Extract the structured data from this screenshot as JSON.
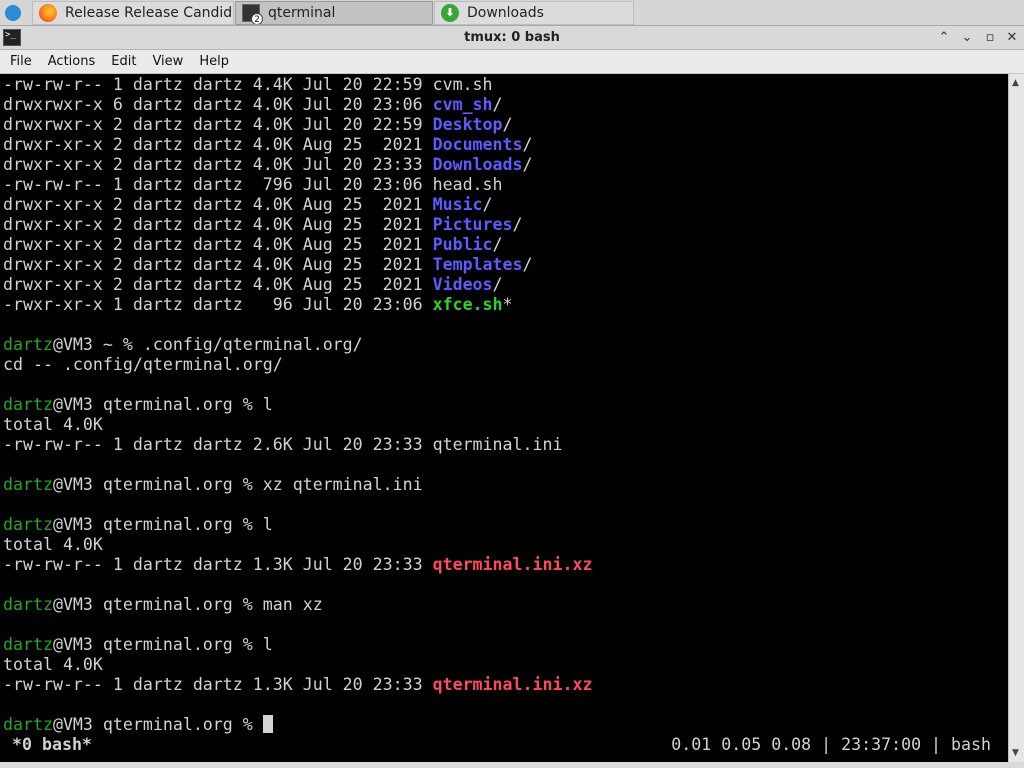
{
  "taskbar": {
    "tasks": [
      {
        "label": "Release Release Candid...",
        "icon": "firefox-icon"
      },
      {
        "label": "qterminal",
        "icon": "terminal-icon",
        "badge": "2"
      },
      {
        "label": "Downloads",
        "icon": "download-icon",
        "glyph": "⬇"
      }
    ]
  },
  "window": {
    "title": "tmux: 0 bash",
    "icon_glyph": ">_",
    "controls": {
      "minimize": "⌃",
      "restore": "⌄",
      "maximize": "▫",
      "close": "✕"
    }
  },
  "menu": {
    "file": "File",
    "actions": "Actions",
    "edit": "Edit",
    "view": "View",
    "help": "Help"
  },
  "terminal": {
    "listing": [
      {
        "meta": "-rw-rw-r-- 1 dartz dartz 4.4K Jul 20 22:59 ",
        "name": "cvm.sh",
        "suffix": "",
        "kind": "plain"
      },
      {
        "meta": "drwxrwxr-x 6 dartz dartz 4.0K Jul 20 23:06 ",
        "name": "cvm_sh",
        "suffix": "/",
        "kind": "dir"
      },
      {
        "meta": "drwxrwxr-x 2 dartz dartz 4.0K Jul 20 22:59 ",
        "name": "Desktop",
        "suffix": "/",
        "kind": "dir"
      },
      {
        "meta": "drwxr-xr-x 2 dartz dartz 4.0K Aug 25  2021 ",
        "name": "Documents",
        "suffix": "/",
        "kind": "dir"
      },
      {
        "meta": "drwxr-xr-x 2 dartz dartz 4.0K Jul 20 23:33 ",
        "name": "Downloads",
        "suffix": "/",
        "kind": "dir"
      },
      {
        "meta": "-rw-rw-r-- 1 dartz dartz  796 Jul 20 23:06 ",
        "name": "head.sh",
        "suffix": "",
        "kind": "plain"
      },
      {
        "meta": "drwxr-xr-x 2 dartz dartz 4.0K Aug 25  2021 ",
        "name": "Music",
        "suffix": "/",
        "kind": "dir"
      },
      {
        "meta": "drwxr-xr-x 2 dartz dartz 4.0K Aug 25  2021 ",
        "name": "Pictures",
        "suffix": "/",
        "kind": "dir"
      },
      {
        "meta": "drwxr-xr-x 2 dartz dartz 4.0K Aug 25  2021 ",
        "name": "Public",
        "suffix": "/",
        "kind": "dir"
      },
      {
        "meta": "drwxr-xr-x 2 dartz dartz 4.0K Aug 25  2021 ",
        "name": "Templates",
        "suffix": "/",
        "kind": "dir"
      },
      {
        "meta": "drwxr-xr-x 2 dartz dartz 4.0K Aug 25  2021 ",
        "name": "Videos",
        "suffix": "/",
        "kind": "dir"
      },
      {
        "meta": "-rwxr-xr-x 1 dartz dartz   96 Jul 20 23:06 ",
        "name": "xfce.sh",
        "suffix": "*",
        "kind": "exec"
      }
    ],
    "prompt_user": "dartz",
    "cmd1": "@VM3 ~ % .config/qterminal.org/",
    "cd_echo": "cd -- .config/qterminal.org/",
    "cmd2": "@VM3 qterminal.org % l",
    "total": "total 4.0K",
    "file_meta_a": "-rw-rw-r-- 1 dartz dartz 2.6K Jul 20 23:33 ",
    "file_name_a": "qterminal.ini",
    "cmd3": "@VM3 qterminal.org % xz qterminal.ini",
    "cmd4": "@VM3 qterminal.org % l",
    "file_meta_b": "-rw-rw-r-- 1 dartz dartz 1.3K Jul 20 23:33 ",
    "file_name_b": "qterminal.ini.xz",
    "cmd5": "@VM3 qterminal.org % man xz",
    "cmd6": "@VM3 qterminal.org % l",
    "cmd7": "@VM3 qterminal.org % "
  },
  "tmux_status": {
    "left": "*0 bash*",
    "right": "0.01 0.05 0.08 | 23:37:00 | bash"
  },
  "colors": {
    "directory": "#5c5cff",
    "executable": "#30d030",
    "archive": "#ff4a5c",
    "prompt_user": "#27a327"
  }
}
